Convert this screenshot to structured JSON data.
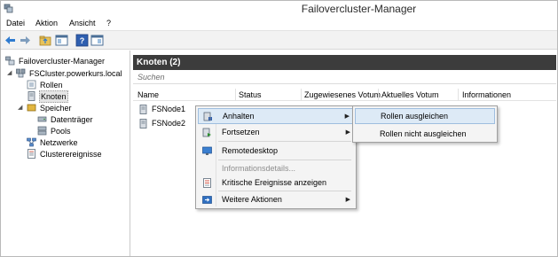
{
  "window": {
    "title": "Failovercluster-Manager"
  },
  "menu": [
    "Datei",
    "Aktion",
    "Ansicht",
    "?"
  ],
  "tree": {
    "root": "Failovercluster-Manager",
    "cluster": "FSCluster.powerkurs.local",
    "rollen": "Rollen",
    "knoten": "Knoten",
    "speicher": "Speicher",
    "datentraeger": "Datenträger",
    "pools": "Pools",
    "netzwerke": "Netzwerke",
    "clusterereignisse": "Clusterereignisse"
  },
  "pane": {
    "title": "Knoten (2)",
    "search_placeholder": "Suchen",
    "columns": [
      "Name",
      "Status",
      "Zugewiesenes Votum",
      "Aktuelles Votum",
      "Informationen"
    ],
    "rows": [
      {
        "name": "FSNode1"
      },
      {
        "name": "FSNode2"
      }
    ]
  },
  "context_menu": {
    "items": [
      {
        "label": "Anhalten",
        "submenu": true
      },
      {
        "label": "Fortsetzen",
        "submenu": true
      },
      {
        "label": "Remotedesktop"
      },
      {
        "label": "Informationsdetails...",
        "disabled": true
      },
      {
        "label": "Kritische Ereignisse anzeigen"
      },
      {
        "label": "Weitere Aktionen",
        "submenu": true
      }
    ]
  },
  "submenu": {
    "items": [
      {
        "label": "Rollen ausgleichen"
      },
      {
        "label": "Rollen nicht ausgleichen"
      }
    ]
  },
  "colors": {
    "header_bg": "#3c3c3c",
    "highlight": "#ddeaf6",
    "highlight_border": "#9ebedf"
  }
}
